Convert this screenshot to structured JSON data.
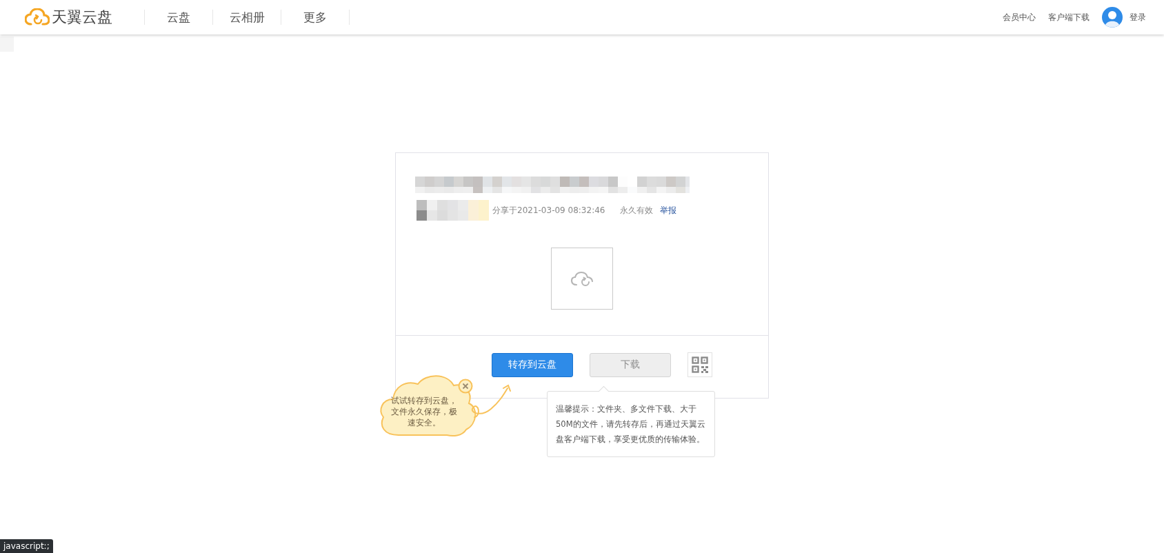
{
  "header": {
    "logo": "天翼云盘",
    "nav": [
      "云盘",
      "云相册",
      "更多"
    ],
    "links": [
      "会员中心",
      "客户端下载"
    ],
    "login": "登录"
  },
  "share": {
    "shared_at": "分享于2021-03-09 08:32:46",
    "validity": "永久有效",
    "report": "举报"
  },
  "actions": {
    "save": "转存到云盘",
    "download": {
      "label": "下载",
      "disabled": true
    }
  },
  "bubble": "试试转存到云盘，文件永久保存，极速安全。",
  "tooltip": "温馨提示：文件夹、多文件下载、大于50M的文件，请先转存后，再通过天翼云盘客户端下载，享受更优质的传输体验。",
  "status_bar": "javascript:;"
}
